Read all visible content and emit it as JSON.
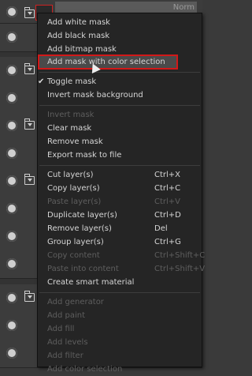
{
  "layer_panel": {
    "blend_mode": "Norm"
  },
  "menu": {
    "group1": [
      "Add white mask",
      "Add black mask",
      "Add bitmap mask",
      "Add mask with color selection"
    ],
    "group2": [
      "Toggle mask",
      "Invert mask background"
    ],
    "group3": [
      "Invert mask",
      "Clear mask",
      "Remove mask",
      "Export mask to file"
    ],
    "group4": [
      {
        "label": "Cut layer(s)",
        "shortcut": "Ctrl+X"
      },
      {
        "label": "Copy layer(s)",
        "shortcut": "Ctrl+C"
      },
      {
        "label": "Paste layer(s)",
        "shortcut": "Ctrl+V"
      },
      {
        "label": "Duplicate layer(s)",
        "shortcut": "Ctrl+D"
      },
      {
        "label": "Remove layer(s)",
        "shortcut": "Del"
      },
      {
        "label": "Group layer(s)",
        "shortcut": "Ctrl+G"
      },
      {
        "label": "Copy content",
        "shortcut": "Ctrl+Shift+C"
      },
      {
        "label": "Paste into content",
        "shortcut": "Ctrl+Shift+V"
      },
      {
        "label": "Create smart material",
        "shortcut": ""
      }
    ],
    "group5": [
      "Add generator",
      "Add paint",
      "Add fill",
      "Add levels",
      "Add filter",
      "Add color selection"
    ],
    "checkmark": "✔"
  }
}
